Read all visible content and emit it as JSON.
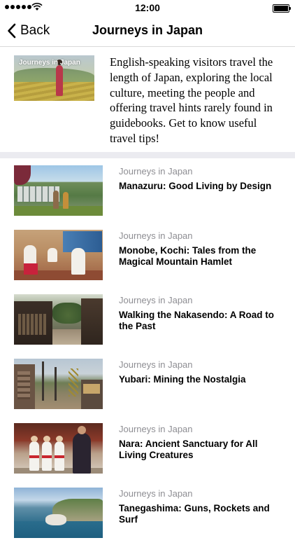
{
  "status_bar": {
    "time": "12:00"
  },
  "nav": {
    "back_label": "Back",
    "title": "Journeys in Japan"
  },
  "intro": {
    "thumbnail_label": "Journeys in Japan",
    "description": "English-speaking visitors travel the length of Japan, exploring the local culture, meeting the people and offering travel hints rarely found in guidebooks. Get to know useful travel tips!"
  },
  "episodes": [
    {
      "series": "Journeys in Japan",
      "title": "Manazuru: Good Living by Design"
    },
    {
      "series": "Journeys in Japan",
      "title": "Monobe, Kochi: Tales from the Magical Mountain Hamlet"
    },
    {
      "series": "Journeys in Japan",
      "title": "Walking the Nakasendo: A Road to the Past"
    },
    {
      "series": "Journeys in Japan",
      "title": "Yubari: Mining the Nostalgia"
    },
    {
      "series": "Journeys in Japan",
      "title": "Nara: Ancient Sanctuary for All Living Creatures"
    },
    {
      "series": "Journeys in Japan",
      "title": "Tanegashima: Guns, Rockets and Surf"
    }
  ],
  "icons": {
    "back": "chevron-left-icon",
    "signal": "signal-dots-icon",
    "wifi": "wifi-icon",
    "battery": "battery-icon"
  }
}
